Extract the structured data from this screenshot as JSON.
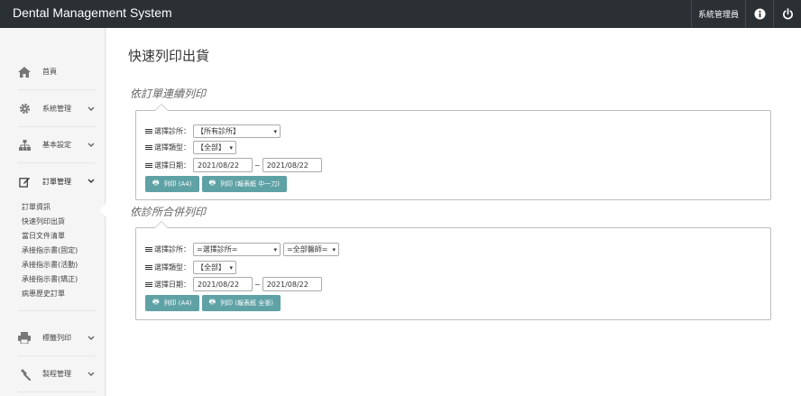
{
  "app": {
    "title": "Dental Management System"
  },
  "header": {
    "user": "系統管理員"
  },
  "sidebar": {
    "items": [
      {
        "label": "首頁",
        "icon": "home-icon"
      },
      {
        "label": "系統管理",
        "icon": "gear-icon"
      },
      {
        "label": "基本設定",
        "icon": "sitemap-icon"
      },
      {
        "label": "訂單管理",
        "icon": "edit-icon"
      },
      {
        "label": "標籤列印",
        "icon": "printer-icon"
      },
      {
        "label": "製程管理",
        "icon": "hammer-icon"
      }
    ],
    "sub_items": [
      "訂單資訊",
      "快速列印出貨",
      "當日文件清單",
      "承接指示書(固定)",
      "承接指示書(活動)",
      "承接指示書(矯正)",
      "病患歷史訂單"
    ]
  },
  "main": {
    "page_title": "快速列印出貨",
    "section1": {
      "title": "依訂單連續列印",
      "clinic_label": "選擇診所：",
      "clinic_value": "【所有診所】",
      "type_label": "選擇類型：",
      "type_value": "【全部】",
      "date_label": "選擇日期：",
      "date_from": "2021/08/22",
      "date_sep": "~",
      "date_to": "2021/08/22",
      "btn_a4": "列印 (A4)",
      "btn_report": "列印 (報表紙 中一刀)"
    },
    "section2": {
      "title": "依診所合併列印",
      "clinic_label": "選擇診所：",
      "clinic_value": "=選擇診所=",
      "doctor_value": "=全部醫師=",
      "type_label": "選擇類型：",
      "type_value": "【全部】",
      "date_label": "選擇日期：",
      "date_from": "2021/08/22",
      "date_sep": "~",
      "date_to": "2021/08/22",
      "btn_a4": "列印 (A4)",
      "btn_report": "列印 (報表紙 全張)"
    }
  },
  "colors": {
    "topbar": "#2b3035",
    "button": "#5fa2a6"
  }
}
